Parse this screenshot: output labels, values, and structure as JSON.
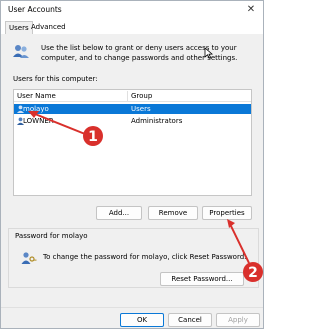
{
  "window": {
    "title": "User Accounts",
    "close_glyph": "✕"
  },
  "tabs": [
    {
      "label": "Users"
    },
    {
      "label": "Advanced"
    }
  ],
  "intro": {
    "text": "Use the list below to grant or deny users access to your computer, and to change passwords and other settings."
  },
  "users_section": {
    "label": "Users for this computer:",
    "columns": [
      "User Name",
      "Group"
    ],
    "rows": [
      {
        "name": "molayo",
        "group": "Users",
        "selected": true
      },
      {
        "name": "LOWNER",
        "group": "Administrators",
        "selected": false
      }
    ]
  },
  "buttons": {
    "add": "Add...",
    "remove": "Remove",
    "properties": "Properties"
  },
  "password_group": {
    "title": "Password for molayo",
    "text": "To change the password for molayo, click Reset Password.",
    "reset": "Reset Password..."
  },
  "footer": {
    "ok": "OK",
    "cancel": "Cancel",
    "apply": "Apply"
  },
  "annotations": [
    {
      "number": "1"
    },
    {
      "number": "2"
    }
  ],
  "colors": {
    "selection": "#0a78d7",
    "annotation": "#d9302c"
  }
}
